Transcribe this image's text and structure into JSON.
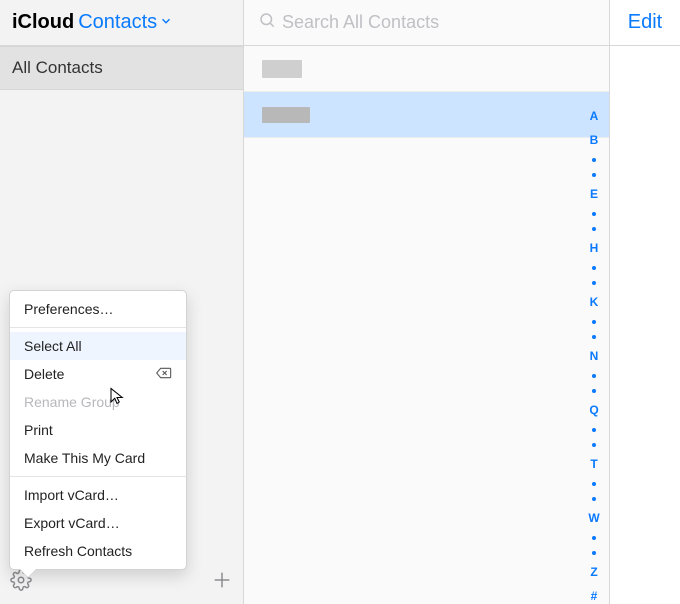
{
  "header": {
    "brand_prefix": "iCloud",
    "app_name": "Contacts"
  },
  "search": {
    "placeholder": "Search All Contacts"
  },
  "edit": {
    "label": "Edit"
  },
  "sidebar": {
    "all_contacts": "All Contacts"
  },
  "index_letters": [
    "A",
    "B",
    "E",
    "H",
    "K",
    "N",
    "Q",
    "T",
    "W",
    "Z",
    "#"
  ],
  "context_menu": {
    "preferences": "Preferences…",
    "select_all": "Select All",
    "delete": "Delete",
    "rename_group": "Rename Group",
    "print": "Print",
    "make_my_card": "Make This My Card",
    "import_vcard": "Import vCard…",
    "export_vcard": "Export vCard…",
    "refresh": "Refresh Contacts"
  }
}
